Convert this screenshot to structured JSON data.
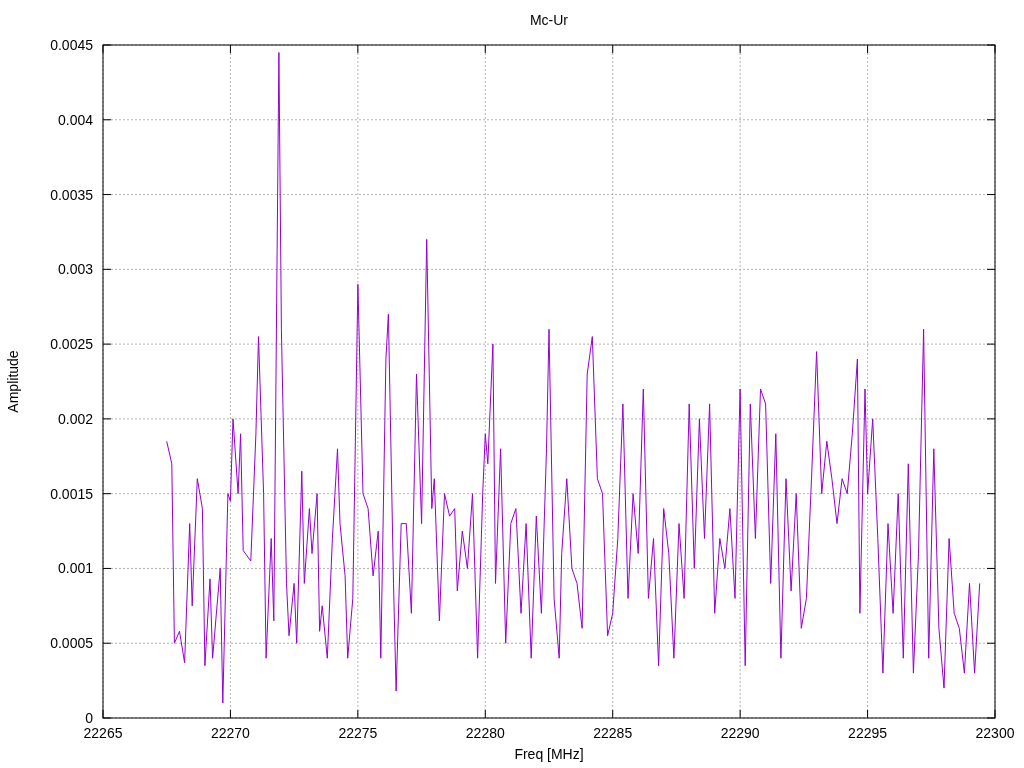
{
  "chart_data": {
    "type": "line",
    "title": "Mc-Ur",
    "xlabel": "Freq [MHz]",
    "ylabel": "Amplitude",
    "xlim": [
      22265,
      22300
    ],
    "ylim": [
      0,
      0.0045
    ],
    "grid": true,
    "xticks": [
      22265,
      22270,
      22275,
      22280,
      22285,
      22290,
      22295,
      22300
    ],
    "yticks": [
      0,
      0.0005,
      0.001,
      0.0015,
      0.002,
      0.0025,
      0.003,
      0.0035,
      0.004,
      0.0045
    ],
    "x": [
      22267.5,
      22267.7,
      22267.8,
      22268.0,
      22268.2,
      22268.4,
      22268.5,
      22268.7,
      22268.9,
      22269.0,
      22269.2,
      22269.3,
      22269.6,
      22269.7,
      22269.9,
      22270.0,
      22270.1,
      22270.3,
      22270.4,
      22270.5,
      22270.8,
      22271.0,
      22271.1,
      22271.3,
      22271.4,
      22271.6,
      22271.7,
      22271.9,
      22272.0,
      22272.2,
      22272.3,
      22272.5,
      22272.6,
      22272.8,
      22272.9,
      22273.1,
      22273.2,
      22273.4,
      22273.5,
      22273.6,
      22273.8,
      22274.0,
      22274.2,
      22274.3,
      22274.5,
      22274.6,
      22274.8,
      22275.0,
      22275.2,
      22275.4,
      22275.6,
      22275.8,
      22275.9,
      22276.1,
      22276.2,
      22276.4,
      22276.5,
      22276.7,
      22276.9,
      22277.1,
      22277.3,
      22277.5,
      22277.7,
      22277.9,
      22278.0,
      22278.2,
      22278.4,
      22278.6,
      22278.8,
      22278.9,
      22279.1,
      22279.3,
      22279.5,
      22279.7,
      22279.9,
      22280.0,
      22280.1,
      22280.3,
      22280.4,
      22280.6,
      22280.8,
      22281.0,
      22281.2,
      22281.4,
      22281.6,
      22281.8,
      22282.0,
      22282.2,
      22282.4,
      22282.5,
      22282.7,
      22282.9,
      22283.0,
      22283.2,
      22283.4,
      22283.6,
      22283.8,
      22284.0,
      22284.2,
      22284.4,
      22284.6,
      22284.8,
      22285.0,
      22285.2,
      22285.4,
      22285.6,
      22285.8,
      22286.0,
      22286.2,
      22286.4,
      22286.6,
      22286.8,
      22287.0,
      22287.2,
      22287.4,
      22287.6,
      22287.8,
      22288.0,
      22288.2,
      22288.4,
      22288.6,
      22288.8,
      22289.0,
      22289.2,
      22289.4,
      22289.6,
      22289.8,
      22290.0,
      22290.2,
      22290.4,
      22290.6,
      22290.8,
      22291.0,
      22291.2,
      22291.4,
      22291.6,
      22291.8,
      22292.0,
      22292.2,
      22292.4,
      22292.6,
      22292.8,
      22293.0,
      22293.2,
      22293.4,
      22293.6,
      22293.8,
      22294.0,
      22294.2,
      22294.4,
      22294.6,
      22294.7,
      22294.9,
      22295.0,
      22295.2,
      22295.4,
      22295.6,
      22295.8,
      22296.0,
      22296.2,
      22296.4,
      22296.6,
      22296.8,
      22297.0,
      22297.2,
      22297.4,
      22297.6,
      22297.8,
      22298.0,
      22298.2,
      22298.4,
      22298.6,
      22298.8,
      22299.0,
      22299.2,
      22299.4
    ],
    "series": [
      {
        "color": "#9400d3",
        "values": [
          0.00185,
          0.0017,
          0.0005,
          0.00058,
          0.00037,
          0.0013,
          0.00075,
          0.0016,
          0.0014,
          0.00035,
          0.00093,
          0.0004,
          0.001,
          0.0001,
          0.0015,
          0.00145,
          0.002,
          0.0015,
          0.0019,
          0.00112,
          0.00105,
          0.0019,
          0.00255,
          0.0015,
          0.0004,
          0.0012,
          0.00065,
          0.00445,
          0.0026,
          0.0009,
          0.00055,
          0.0009,
          0.0005,
          0.00165,
          0.0009,
          0.0014,
          0.0011,
          0.0015,
          0.00058,
          0.00075,
          0.0004,
          0.0012,
          0.0018,
          0.0013,
          0.00095,
          0.0004,
          0.0008,
          0.0029,
          0.0015,
          0.0014,
          0.00095,
          0.00125,
          0.0004,
          0.0024,
          0.0027,
          0.0009,
          0.00018,
          0.0013,
          0.0013,
          0.0007,
          0.0023,
          0.0013,
          0.0032,
          0.0014,
          0.0016,
          0.00065,
          0.0015,
          0.00135,
          0.0014,
          0.00085,
          0.00125,
          0.001,
          0.0015,
          0.0004,
          0.0015,
          0.0019,
          0.0017,
          0.0025,
          0.0009,
          0.0018,
          0.0005,
          0.0013,
          0.0014,
          0.0007,
          0.0013,
          0.0004,
          0.00135,
          0.0007,
          0.0018,
          0.0026,
          0.0008,
          0.0004,
          0.0011,
          0.0016,
          0.001,
          0.0009,
          0.0006,
          0.0023,
          0.00255,
          0.0016,
          0.0015,
          0.00055,
          0.0007,
          0.0012,
          0.0021,
          0.0008,
          0.0015,
          0.0011,
          0.0022,
          0.0008,
          0.0012,
          0.00035,
          0.0014,
          0.0011,
          0.0004,
          0.0013,
          0.0008,
          0.0021,
          0.001,
          0.002,
          0.0012,
          0.0021,
          0.0007,
          0.0012,
          0.001,
          0.0014,
          0.0008,
          0.0022,
          0.00035,
          0.0021,
          0.0012,
          0.0022,
          0.0021,
          0.0009,
          0.0019,
          0.0004,
          0.0016,
          0.00085,
          0.0015,
          0.0006,
          0.0008,
          0.0016,
          0.00245,
          0.0015,
          0.00185,
          0.0016,
          0.0013,
          0.0016,
          0.0015,
          0.0019,
          0.0024,
          0.0007,
          0.0022,
          0.0015,
          0.002,
          0.0012,
          0.0003,
          0.0013,
          0.0007,
          0.0015,
          0.0004,
          0.0017,
          0.0003,
          0.0011,
          0.0026,
          0.0004,
          0.0018,
          0.0006,
          0.0002,
          0.0012,
          0.0007,
          0.0006,
          0.0003,
          0.0009,
          0.0003,
          0.0009
        ]
      }
    ]
  }
}
